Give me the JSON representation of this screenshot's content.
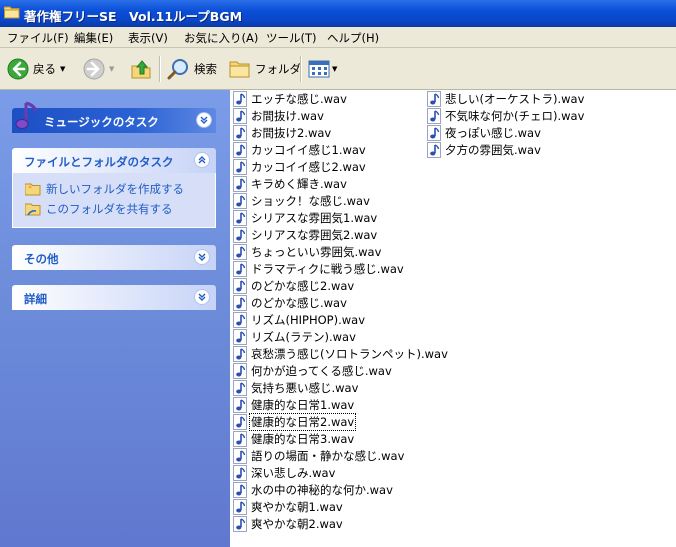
{
  "window": {
    "title": "著作権フリーSE　Vol.11ループBGM"
  },
  "menu": [
    "ファイル(F)",
    "編集(E)",
    "表示(V)",
    "お気に入り(A)",
    "ツール(T)",
    "ヘルプ(H)"
  ],
  "toolbar": {
    "back": "戻る",
    "search": "検索",
    "folders": "フォルダ"
  },
  "taskpane": {
    "music_tasks": "ミュージックのタスク",
    "file_folder_tasks": "ファイルとフォルダのタスク",
    "tasks": [
      "新しいフォルダを作成する",
      "このフォルダを共有する"
    ],
    "other": "その他",
    "details": "詳細"
  },
  "files": {
    "column1": [
      "エッチな感じ.wav",
      "お間抜け.wav",
      "お間抜け2.wav",
      "カッコイイ感じ1.wav",
      "カッコイイ感じ2.wav",
      "キラめく輝き.wav",
      "ショック！な感じ.wav",
      "シリアスな雰囲気1.wav",
      "シリアスな雰囲気2.wav",
      "ちょっといい雰囲気.wav",
      "ドラマティクに戦う感じ.wav",
      "のどかな感じ2.wav",
      "のどかな感じ.wav",
      "リズム(HIPHOP).wav",
      "リズム(ラテン).wav",
      "哀愁漂う感じ(ソロトランペット).wav",
      "何かが迫ってくる感じ.wav",
      "気持ち悪い感じ.wav",
      "健康的な日常1.wav",
      "健康的な日常2.wav",
      "健康的な日常3.wav",
      "語りの場面・静かな感じ.wav",
      "深い悲しみ.wav",
      "水の中の神秘的な何か.wav",
      "爽やかな朝1.wav",
      "爽やかな朝2.wav"
    ],
    "column2": [
      "悲しい(オーケストラ).wav",
      "不気味な何か(チェロ).wav",
      "夜っぽい感じ.wav",
      "夕方の雰囲気.wav"
    ]
  }
}
